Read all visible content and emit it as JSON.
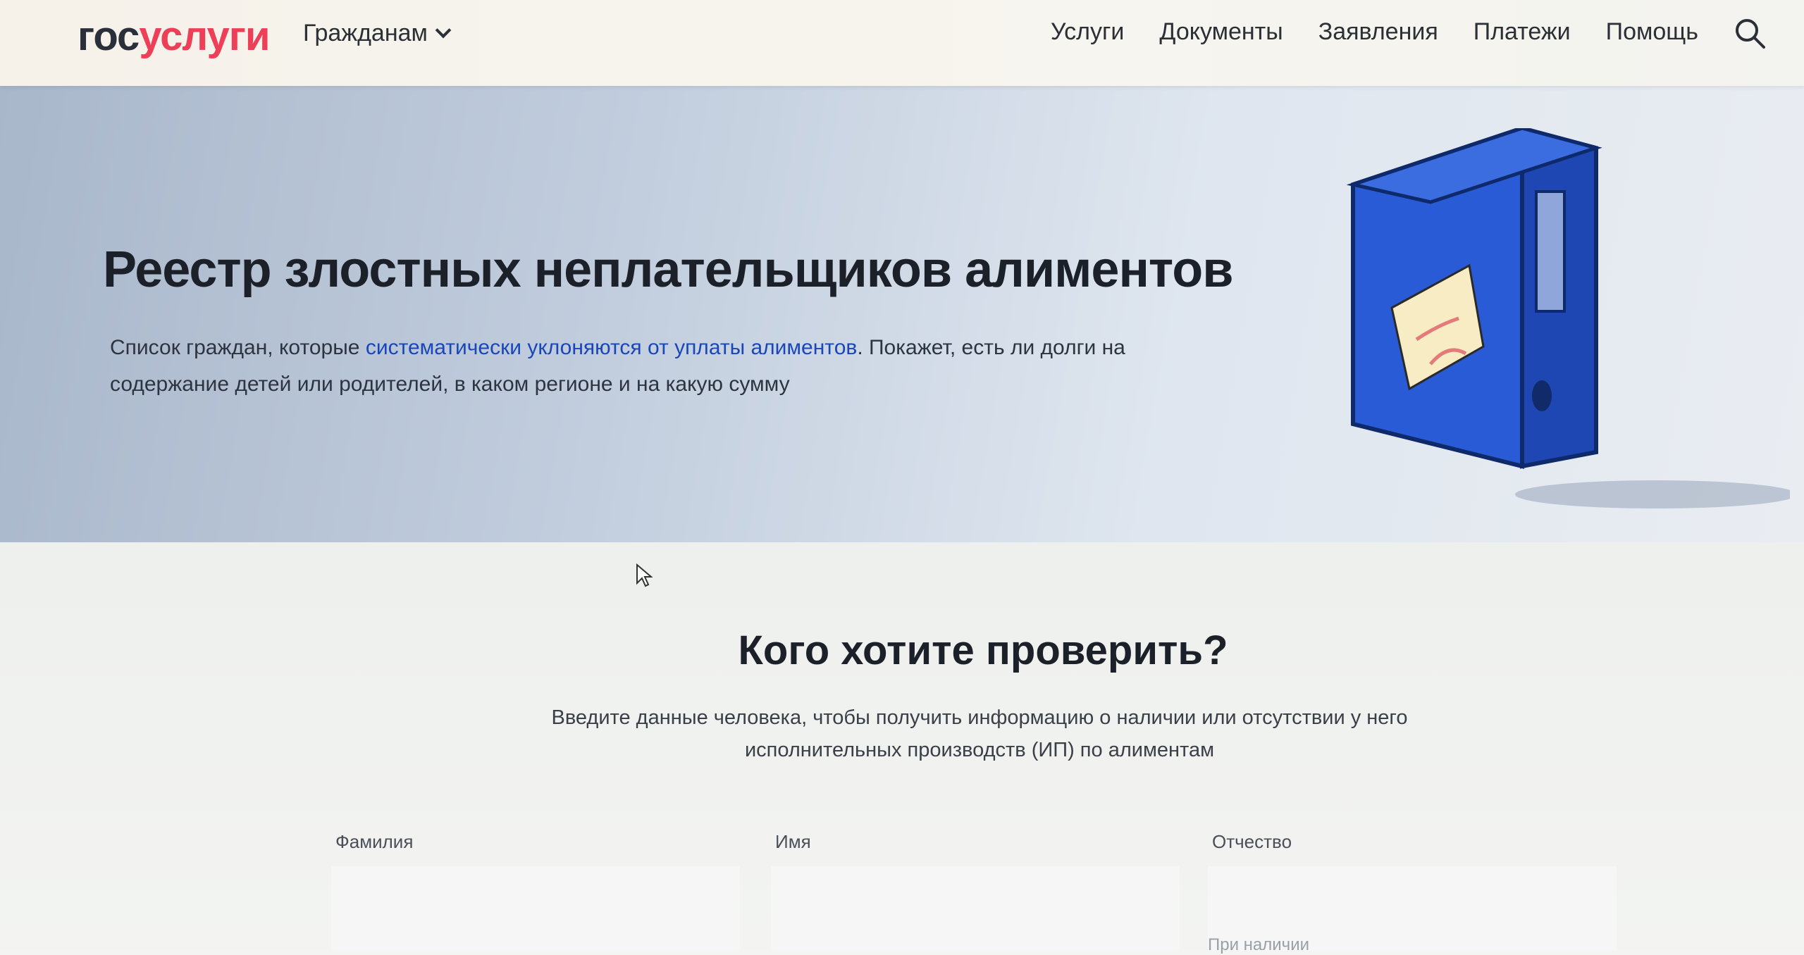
{
  "header": {
    "logo": {
      "part1": "гос",
      "part2": "услуги"
    },
    "role_menu": "Гражданам",
    "nav": [
      "Услуги",
      "Документы",
      "Заявления",
      "Платежи",
      "Помощь"
    ]
  },
  "hero": {
    "title": "Реестр злостных неплательщиков алиментов",
    "desc_before": "Список граждан, которые ",
    "desc_link": "систематически уклоняются от уплаты алиментов",
    "desc_after": ". Покажет, есть ли долги на содержание детей или родителей, в каком регионе и на какую сумму"
  },
  "check": {
    "title": "Кого хотите проверить?",
    "description": "Введите данные человека, чтобы получить информацию о наличии или отсутствии у него исполнительных производств (ИП) по алиментам",
    "fields": [
      {
        "label": "Фамилия",
        "value": ""
      },
      {
        "label": "Имя",
        "value": ""
      },
      {
        "label": "Отчество",
        "value": "",
        "hint": "При наличии"
      }
    ]
  },
  "colors": {
    "brand_blue": "#0d4cd3",
    "brand_red": "#ee3f58",
    "link": "#1a47b8",
    "folder_blue": "#2a5bd7"
  }
}
